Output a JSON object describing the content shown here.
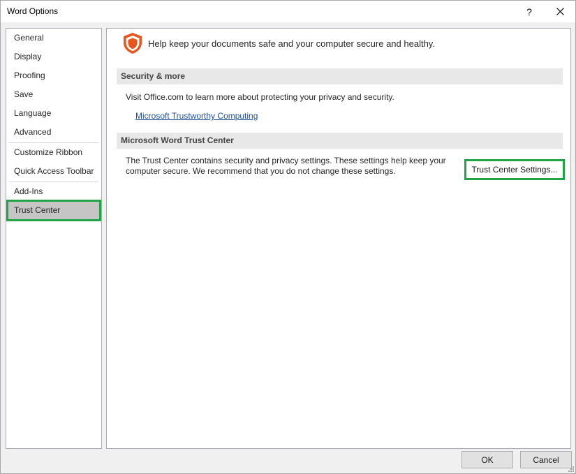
{
  "window": {
    "title": "Word Options",
    "help_label": "?"
  },
  "sidebar": {
    "items": [
      {
        "label": "General"
      },
      {
        "label": "Display"
      },
      {
        "label": "Proofing"
      },
      {
        "label": "Save"
      },
      {
        "label": "Language"
      },
      {
        "label": "Advanced"
      },
      {
        "label": "Customize Ribbon"
      },
      {
        "label": "Quick Access Toolbar"
      },
      {
        "label": "Add-Ins"
      },
      {
        "label": "Trust Center"
      }
    ],
    "selected": "Trust Center"
  },
  "main": {
    "header_icon": "shield-icon",
    "header_text": "Help keep your documents safe and your computer secure and healthy.",
    "security_section": {
      "title": "Security & more",
      "description": "Visit Office.com to learn more about protecting your privacy and security.",
      "link_label": "Microsoft Trustworthy Computing"
    },
    "trust_section": {
      "title": "Microsoft Word Trust Center",
      "description_line1": "The Trust Center contains security and privacy settings. These settings help keep your",
      "description_line2": "computer secure. We recommend that you do not change these settings.",
      "button_label": "Trust Center Settings..."
    }
  },
  "footer": {
    "ok_label": "OK",
    "cancel_label": "Cancel"
  },
  "colors": {
    "highlight": "#21a346",
    "shield": "#e8561e",
    "link": "#1f4e9c",
    "selected_bg": "#c5c5c5"
  }
}
